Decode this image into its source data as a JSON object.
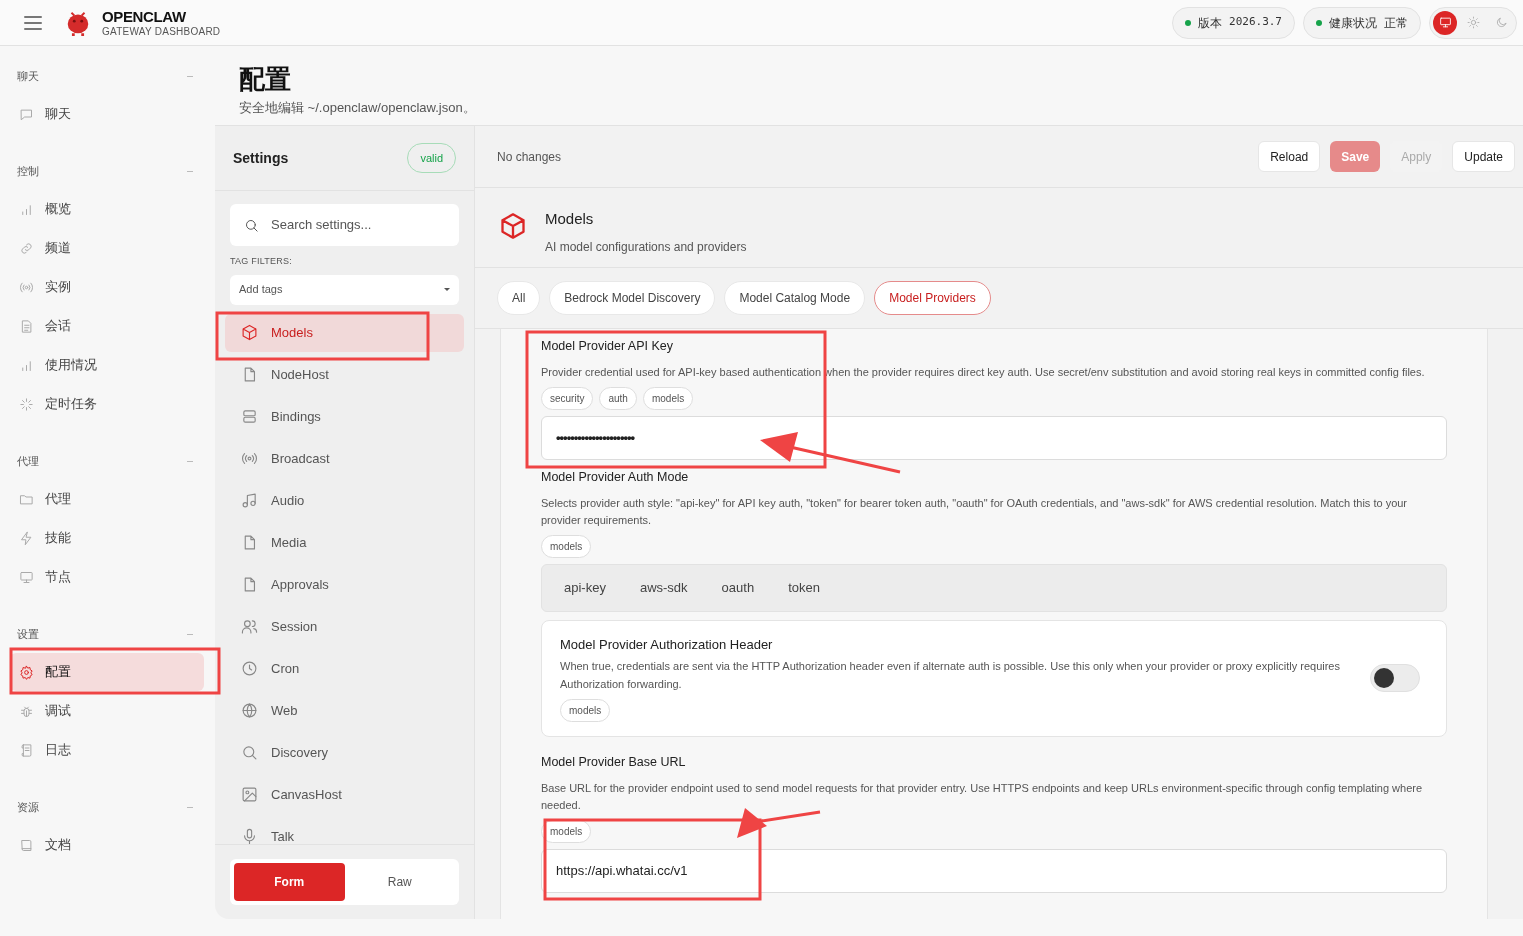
{
  "header": {
    "brand": "OPENCLAW",
    "subtitle": "GATEWAY DASHBOARD",
    "pills": [
      {
        "label": "版本",
        "value": "2026.3.7",
        "color": "#16a34a"
      },
      {
        "label": "健康状况",
        "value": "正常",
        "color": "#16a34a"
      }
    ],
    "theme": [
      {
        "kind": "system",
        "selected": true
      },
      {
        "kind": "light",
        "selected": false
      },
      {
        "kind": "dark",
        "selected": false
      }
    ]
  },
  "nav": [
    {
      "title": "聊天",
      "items": [
        {
          "label": "聊天",
          "kind": "chat",
          "selected": false
        }
      ]
    },
    {
      "title": "控制",
      "items": [
        {
          "label": "概览",
          "kind": "bars",
          "selected": false
        },
        {
          "label": "频道",
          "kind": "link",
          "selected": false
        },
        {
          "label": "实例",
          "kind": "radio",
          "selected": false
        },
        {
          "label": "会话",
          "kind": "doc",
          "selected": false
        },
        {
          "label": "使用情况",
          "kind": "bars",
          "selected": false
        },
        {
          "label": "定时任务",
          "kind": "loader",
          "selected": false
        }
      ]
    },
    {
      "title": "代理",
      "items": [
        {
          "label": "代理",
          "kind": "folder",
          "selected": false
        },
        {
          "label": "技能",
          "kind": "bolt",
          "selected": false
        },
        {
          "label": "节点",
          "kind": "monitor",
          "selected": false
        }
      ]
    },
    {
      "title": "设置",
      "items": [
        {
          "label": "配置",
          "kind": "gear",
          "selected": true
        },
        {
          "label": "调试",
          "kind": "bug",
          "selected": false
        },
        {
          "label": "日志",
          "kind": "scroll",
          "selected": false
        }
      ]
    },
    {
      "title": "资源",
      "items": [
        {
          "label": "文档",
          "kind": "book",
          "selected": false
        }
      ]
    }
  ],
  "page": {
    "title": "配置",
    "subtitle": "安全地编辑 ~/.openclaw/openclaw.json。"
  },
  "settings": {
    "title": "Settings",
    "badge": "valid",
    "search_placeholder": "Search settings...",
    "tag_filters_label": "TAG FILTERS:",
    "tags_placeholder": "Add tags",
    "sections": [
      {
        "label": "Models",
        "kind": "cube",
        "selected": true
      },
      {
        "label": "NodeHost",
        "kind": "file",
        "selected": false
      },
      {
        "label": "Bindings",
        "kind": "rows",
        "selected": false
      },
      {
        "label": "Broadcast",
        "kind": "radio",
        "selected": false
      },
      {
        "label": "Audio",
        "kind": "music",
        "selected": false
      },
      {
        "label": "Media",
        "kind": "file",
        "selected": false
      },
      {
        "label": "Approvals",
        "kind": "file",
        "selected": false
      },
      {
        "label": "Session",
        "kind": "users",
        "selected": false
      },
      {
        "label": "Cron",
        "kind": "clock",
        "selected": false
      },
      {
        "label": "Web",
        "kind": "globe",
        "selected": false
      },
      {
        "label": "Discovery",
        "kind": "search",
        "selected": false
      },
      {
        "label": "CanvasHost",
        "kind": "image",
        "selected": false
      },
      {
        "label": "Talk",
        "kind": "mic",
        "selected": false
      }
    ],
    "modes": [
      {
        "label": "Form",
        "selected": true
      },
      {
        "label": "Raw",
        "selected": false
      }
    ]
  },
  "toolbar": {
    "status": "No changes",
    "buttons": [
      {
        "label": "Reload",
        "kind": "default",
        "disabled": false
      },
      {
        "label": "Save",
        "kind": "primary",
        "disabled": true
      },
      {
        "label": "Apply",
        "kind": "default",
        "disabled": true
      },
      {
        "label": "Update",
        "kind": "default",
        "disabled": false
      }
    ]
  },
  "section": {
    "title": "Models",
    "description": "AI model configurations and providers"
  },
  "filter_tabs": [
    {
      "label": "All",
      "selected": false
    },
    {
      "label": "Bedrock Model Discovery",
      "selected": false
    },
    {
      "label": "Model Catalog Mode",
      "selected": false
    },
    {
      "label": "Model Providers",
      "selected": true
    }
  ],
  "fields": [
    {
      "kind": "secret",
      "label": "Model Provider API Key",
      "description": "Provider credential used for API-key based authentication when the provider requires direct key auth. Use secret/env substitution and avoid storing real keys in committed config files.",
      "tags": [
        "security",
        "auth",
        "models"
      ],
      "value": "••••••••••••••••••••••"
    },
    {
      "kind": "choice",
      "label": "Model Provider Auth Mode",
      "description": "Selects provider auth style: \"api-key\" for API key auth, \"token\" for bearer token auth, \"oauth\" for OAuth credentials, and \"aws-sdk\" for AWS credential resolution. Match this to your provider requirements.",
      "tags": [
        "models"
      ],
      "options": [
        {
          "label": "api-key",
          "selected": false
        },
        {
          "label": "aws-sdk",
          "selected": false
        },
        {
          "label": "oauth",
          "selected": false
        },
        {
          "label": "token",
          "selected": false
        }
      ]
    },
    {
      "kind": "toggle",
      "label": "Model Provider Authorization Header",
      "description": "When true, credentials are sent via the HTTP Authorization header even if alternate auth is possible. Use this only when your provider or proxy explicitly requires Authorization forwarding.",
      "tags": [
        "models"
      ],
      "on": false
    },
    {
      "kind": "text",
      "label": "Model Provider Base URL",
      "description": "Base URL for the provider endpoint used to send model requests for that provider entry. Use HTTPS endpoints and keep URLs environment-specific through config templating where needed.",
      "tags": [
        "models"
      ],
      "value": "https://api.whatai.cc/v1"
    }
  ]
}
